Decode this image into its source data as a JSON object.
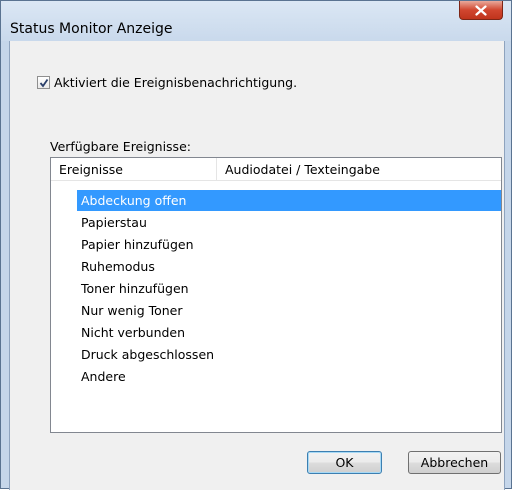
{
  "window": {
    "title": "Status Monitor Anzeige",
    "close_glyph": "X"
  },
  "notification_checkbox": {
    "label": "Aktiviert die Ereignisbenachrichtigung.",
    "checked": true
  },
  "events_section": {
    "label": "Verfügbare Ereignisse:",
    "columns": [
      "Ereignisse",
      "Audiodatei / Texteingabe"
    ],
    "rows": [
      {
        "event": "Abdeckung offen",
        "selected": true
      },
      {
        "event": "Papierstau",
        "selected": false
      },
      {
        "event": "Papier hinzufügen",
        "selected": false
      },
      {
        "event": "Ruhemodus",
        "selected": false
      },
      {
        "event": "Toner hinzufügen",
        "selected": false
      },
      {
        "event": "Nur wenig Toner",
        "selected": false
      },
      {
        "event": "Nicht verbunden",
        "selected": false
      },
      {
        "event": "Druck abgeschlossen",
        "selected": false
      },
      {
        "event": "Andere",
        "selected": false
      }
    ]
  },
  "buttons": {
    "ok_label": "OK",
    "cancel_label": "Abbrechen"
  },
  "colors": {
    "selection": "#3399ff",
    "close_button": "#c7432b"
  }
}
